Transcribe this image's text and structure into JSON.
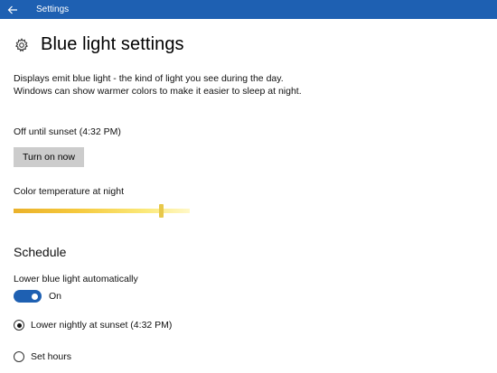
{
  "titlebar": {
    "title": "Settings",
    "background": "#1e60b2",
    "back_icon": "back-arrow-icon"
  },
  "page": {
    "title": "Blue light settings",
    "icon": "gear-icon",
    "description": "Displays emit blue light - the kind of light you see during the day. Windows can show warmer colors to make it easier to sleep at night.",
    "status": "Off until sunset (4:32 PM)",
    "turn_on_label": "Turn on now"
  },
  "color_temperature": {
    "label": "Color temperature at night",
    "value": 0.84
  },
  "schedule": {
    "title": "Schedule",
    "auto_label": "Lower blue light automatically",
    "toggle_state": "On",
    "toggle_on": true,
    "accent": "#1e60b2",
    "options": [
      {
        "label": "Lower nightly at sunset (4:32 PM)",
        "selected": true
      },
      {
        "label": "Set hours",
        "selected": false
      }
    ]
  }
}
